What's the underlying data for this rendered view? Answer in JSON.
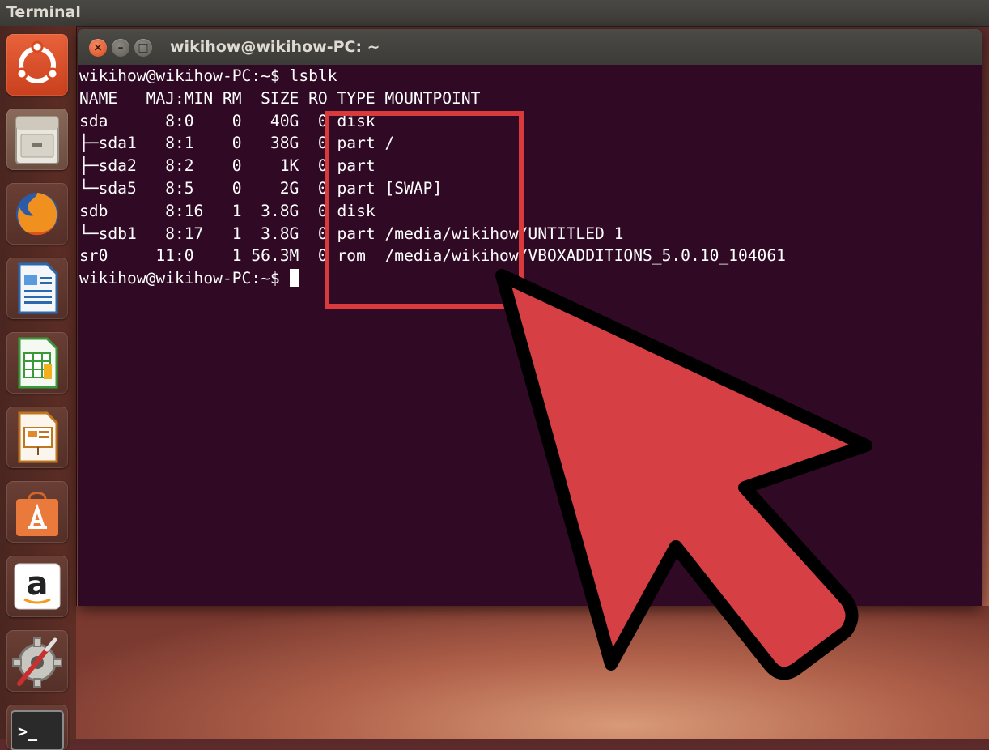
{
  "top_bar": {
    "title": "Terminal"
  },
  "launcher": {
    "items": [
      {
        "name": "ubuntu-dash",
        "icon": "ubuntu-logo-icon"
      },
      {
        "name": "files",
        "icon": "file-cabinet-icon"
      },
      {
        "name": "firefox",
        "icon": "firefox-icon"
      },
      {
        "name": "libreoffice-writer",
        "icon": "writer-document-icon"
      },
      {
        "name": "libreoffice-calc",
        "icon": "calc-spreadsheet-icon"
      },
      {
        "name": "libreoffice-impress",
        "icon": "impress-presentation-icon"
      },
      {
        "name": "software-center",
        "icon": "shopping-bag-icon"
      },
      {
        "name": "amazon",
        "icon": "amazon-icon",
        "label": "a"
      },
      {
        "name": "system-settings",
        "icon": "settings-gear-icon"
      },
      {
        "name": "terminal",
        "icon": "terminal-icon",
        "label": ">_"
      }
    ]
  },
  "window": {
    "title": "wikihow@wikihow-PC: ~",
    "buttons": {
      "close": "×",
      "minimize": "–",
      "maximize": "□"
    }
  },
  "terminal": {
    "lines": [
      "wikihow@wikihow-PC:~$ lsblk",
      "NAME   MAJ:MIN RM  SIZE RO TYPE MOUNTPOINT",
      "sda      8:0    0   40G  0 disk",
      "├─sda1   8:1    0   38G  0 part /",
      "├─sda2   8:2    0    1K  0 part",
      "└─sda5   8:5    0    2G  0 part [SWAP]",
      "sdb      8:16   1  3.8G  0 disk",
      "└─sdb1   8:17   1  3.8G  0 part /media/wikihow/UNTITLED 1",
      "sr0     11:0    1 56.3M  0 rom  /media/wikihow/VBOXADDITIONS_5.0.10_104061"
    ],
    "prompt": "wikihow@wikihow-PC:~$ "
  },
  "annotation": {
    "highlight_color": "#d93a3c",
    "arrow_color": "#d64045",
    "arrow_outline": "#000000"
  },
  "colors": {
    "terminal_bg": "#300a24",
    "terminal_text": "#ffffff",
    "close_button": "#e2582a"
  }
}
